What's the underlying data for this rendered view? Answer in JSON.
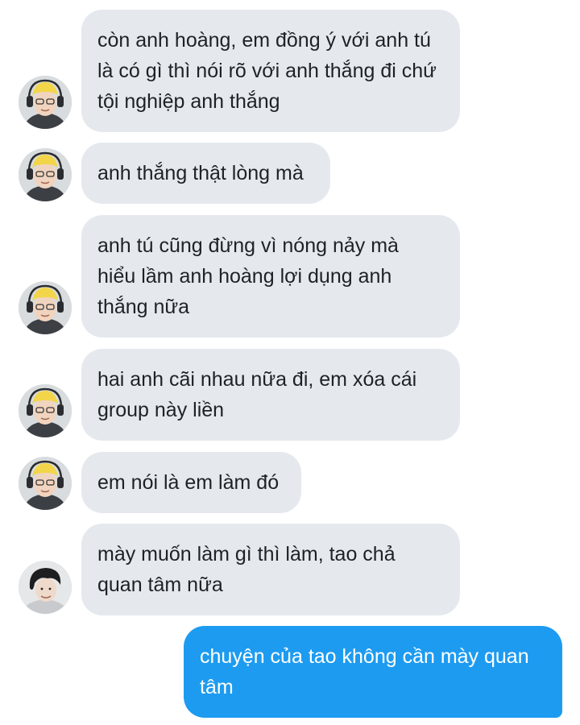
{
  "messages": [
    {
      "direction": "in",
      "sender_avatar": "yellow-beanie-avatar",
      "text": "còn anh hoàng, em đồng ý với anh tú\nlà có gì thì nói rõ với anh thắng đi chứ\ntội nghiệp anh thắng"
    },
    {
      "direction": "in",
      "sender_avatar": "yellow-beanie-avatar",
      "text": "anh thắng thật lòng mà"
    },
    {
      "direction": "in",
      "sender_avatar": "yellow-beanie-avatar",
      "text": "anh tú cũng đừng vì nóng nảy mà\nhiểu lầm anh hoàng lợi dụng anh\nthắng nữa"
    },
    {
      "direction": "in",
      "sender_avatar": "yellow-beanie-avatar",
      "text": "hai anh cãi nhau nữa đi, em xóa cái\ngroup này liền"
    },
    {
      "direction": "in",
      "sender_avatar": "yellow-beanie-avatar",
      "text": "em nói là em làm đó"
    },
    {
      "direction": "in",
      "sender_avatar": "dark-hair-avatar",
      "text": "mày muốn làm gì thì làm, tao chả\nquan tâm nữa"
    },
    {
      "direction": "out",
      "text": "chuyện của tao không cần mày quan\ntâm"
    }
  ],
  "colors": {
    "incoming_bubble": "#e5e9ee",
    "incoming_text": "#1d2226",
    "outgoing_bubble": "#1d9bf0",
    "outgoing_text": "#ffffff"
  }
}
